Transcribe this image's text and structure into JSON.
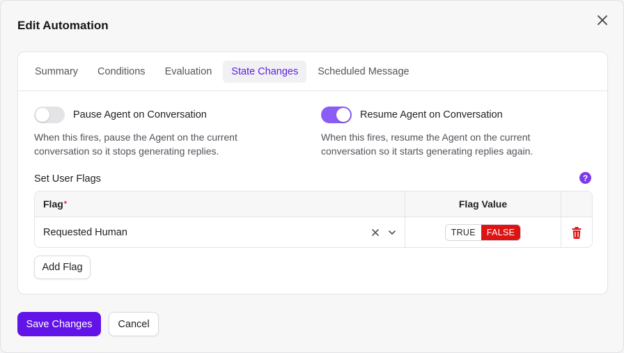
{
  "modal": {
    "title": "Edit Automation"
  },
  "tabs": [
    {
      "label": "Summary",
      "active": false
    },
    {
      "label": "Conditions",
      "active": false
    },
    {
      "label": "Evaluation",
      "active": false
    },
    {
      "label": "State Changes",
      "active": true
    },
    {
      "label": "Scheduled Message",
      "active": false
    }
  ],
  "pause_agent": {
    "label": "Pause Agent on Conversation",
    "description": "When this fires, pause the Agent on the current conversation so it stops generating replies.",
    "enabled": false
  },
  "resume_agent": {
    "label": "Resume Agent on Conversation",
    "description": "When this fires, resume the Agent on the current conversation so it starts generating replies again.",
    "enabled": true
  },
  "user_flags": {
    "title": "Set User Flags",
    "columns": {
      "flag": "Flag",
      "required_mark": "*",
      "value": "Flag Value"
    },
    "rows": [
      {
        "flag": "Requested Human",
        "true_label": "TRUE",
        "false_label": "FALSE",
        "value": false
      }
    ],
    "add_button": "Add Flag"
  },
  "footer": {
    "save_label": "Save Changes",
    "cancel_label": "Cancel"
  },
  "colors": {
    "accent": "#6213e8",
    "toggle_on": "#8b5cf6",
    "false_active": "#dc1414",
    "delete": "#dc1414"
  },
  "icons": [
    "close-icon",
    "help-icon",
    "clear-icon",
    "chevron-down-icon",
    "trash-icon"
  ]
}
